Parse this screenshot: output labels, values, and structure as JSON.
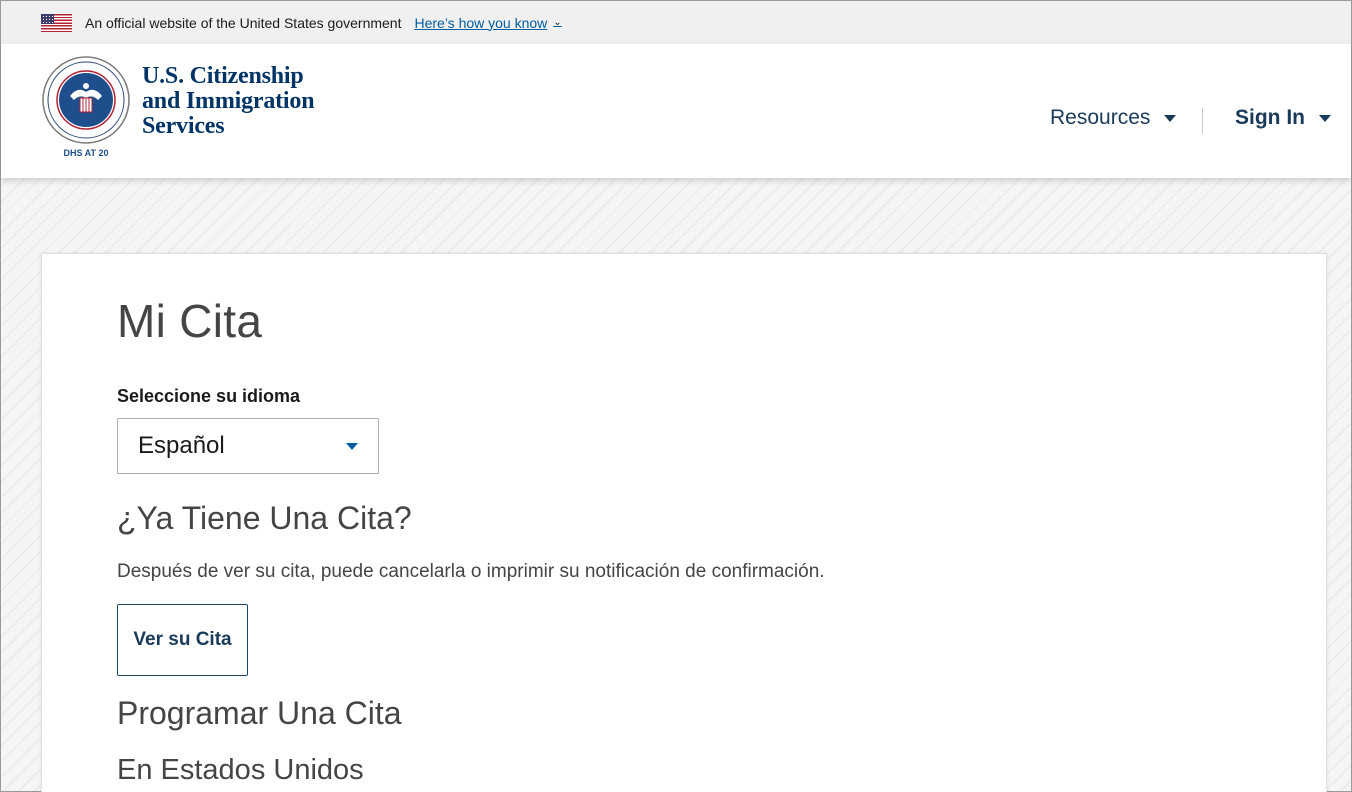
{
  "gov_banner": {
    "text": "An official website of the United States government",
    "link": "Here’s how you know"
  },
  "header": {
    "brand_line1": "U.S. Citizenship",
    "brand_line2": "and Immigration",
    "brand_line3": "Services",
    "seal_text": "DHS AT 20",
    "nav": {
      "resources": "Resources",
      "sign_in": "Sign In"
    }
  },
  "main": {
    "title": "Mi Cita",
    "language_label": "Seleccione su idioma",
    "language_value": "Español",
    "have_heading": "¿Ya Tiene Una Cita?",
    "have_description": "Después de ver su cita, puede cancelarla o imprimir su notificación de confirmación.",
    "view_button": "Ver su Cita",
    "schedule_heading": "Programar Una Cita",
    "us_heading": "En Estados Unidos"
  },
  "colors": {
    "brand": "#003366",
    "link": "#005ea2"
  }
}
